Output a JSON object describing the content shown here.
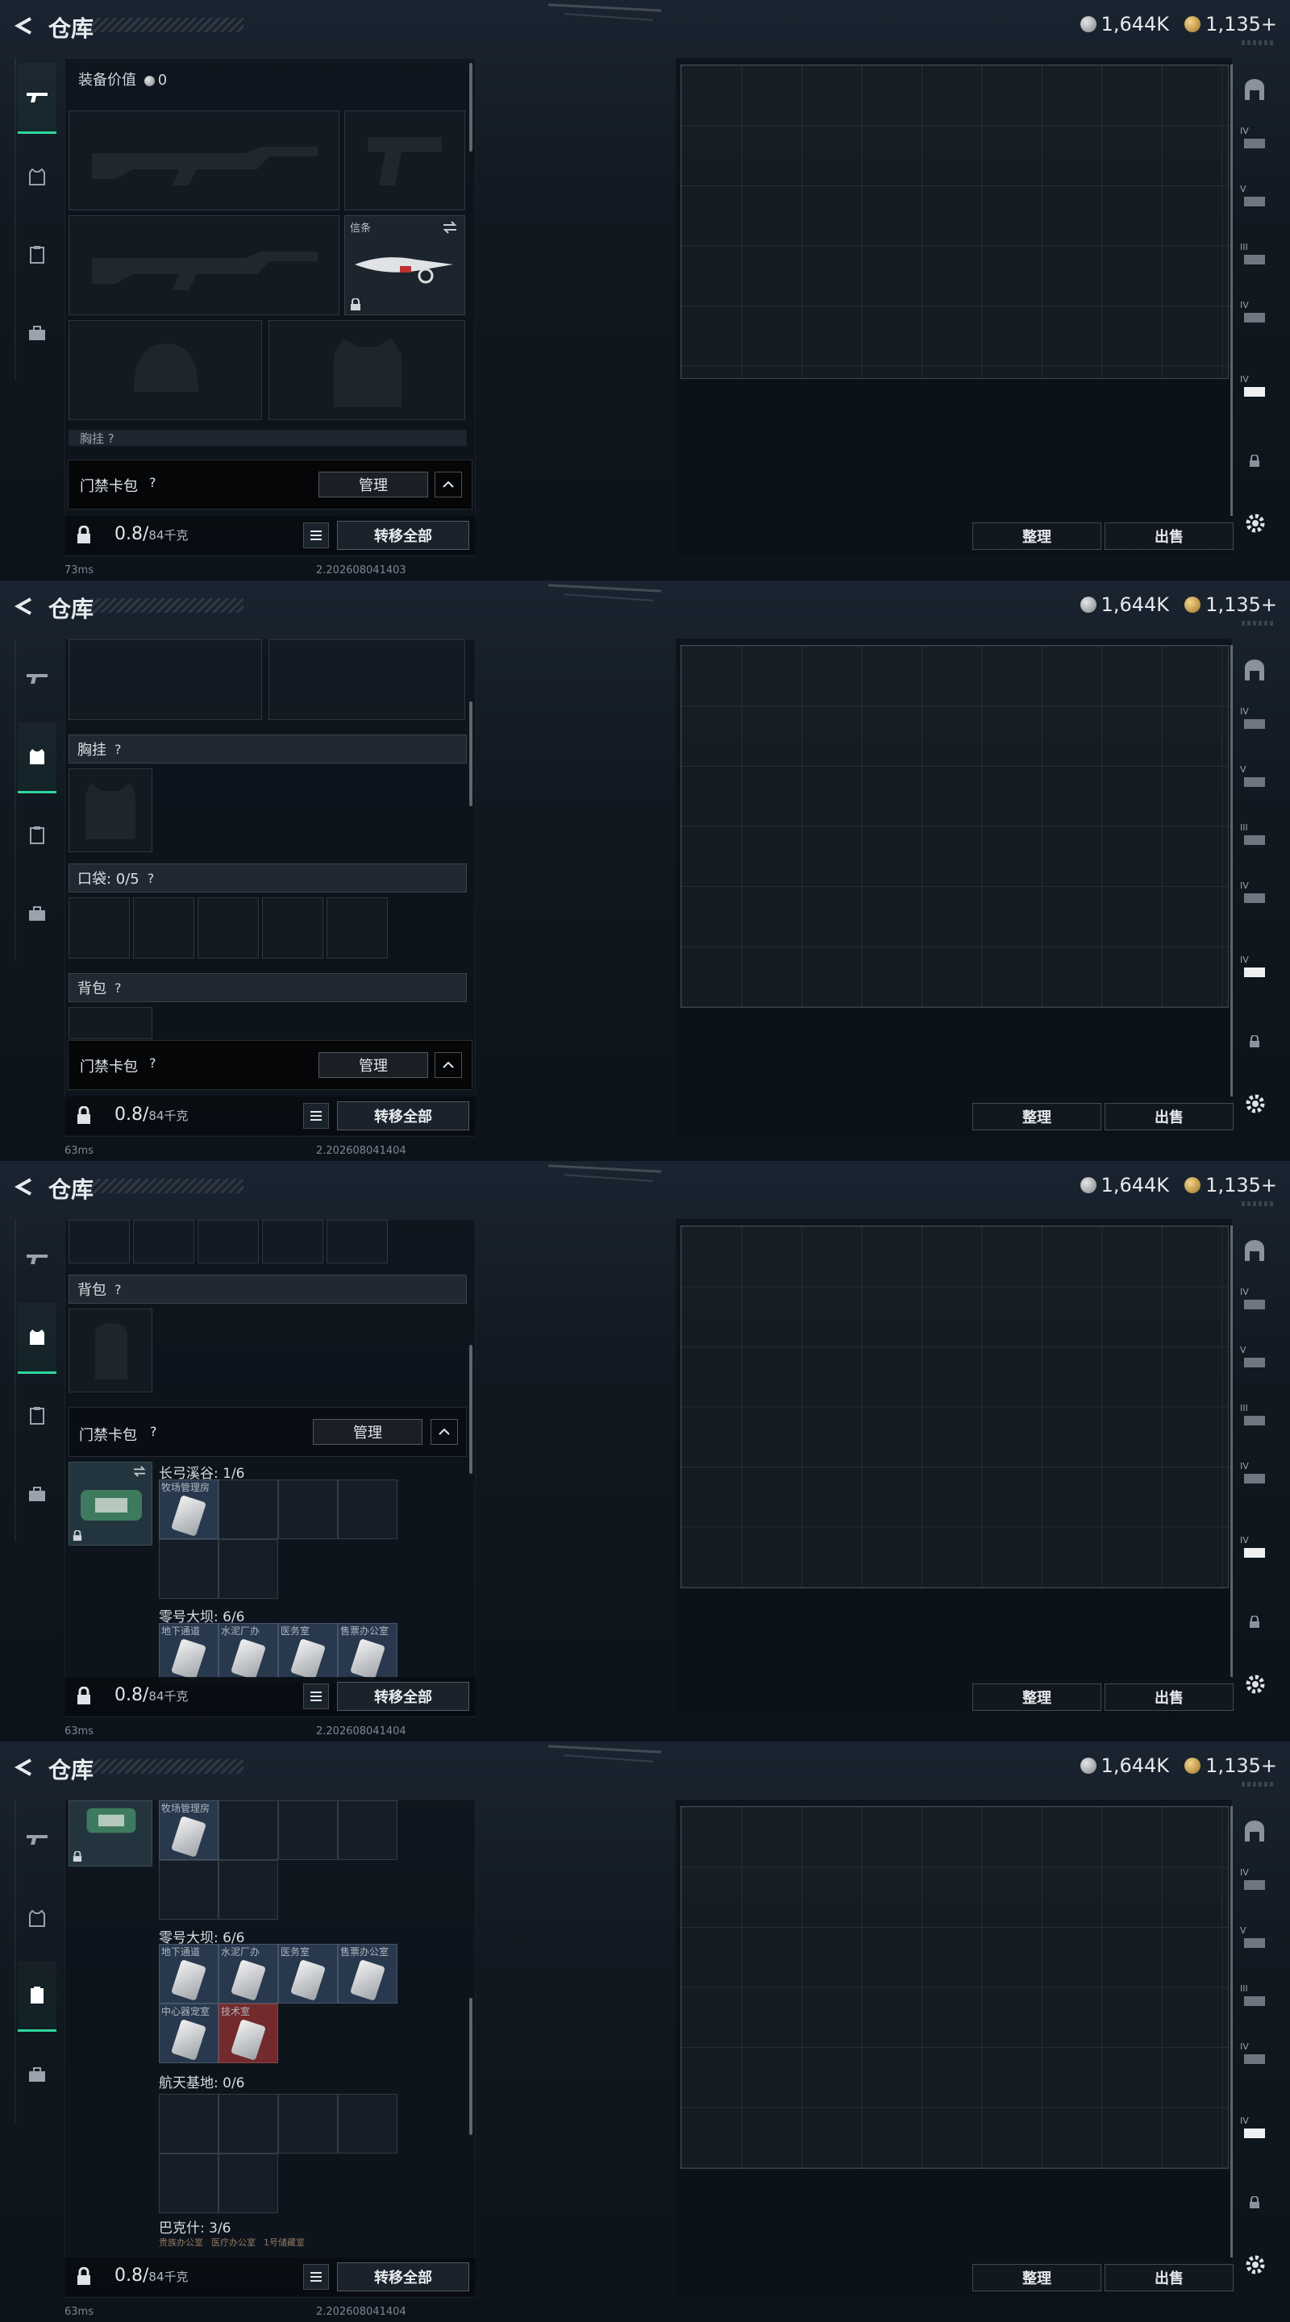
{
  "app": {
    "title": "仓库",
    "currency": {
      "silver": "1,644K",
      "gold": "1,135+"
    },
    "footer": {
      "weight": "0.8/",
      "weight_unit": "84千克",
      "transfer_all": "转移全部"
    },
    "keycard": {
      "label": "门禁卡包",
      "help": "?",
      "manage": "管理"
    },
    "stash_buttons": {
      "sort": "整理",
      "sell": "出售"
    }
  },
  "frames": [
    {
      "status": {
        "ping": "73ms",
        "version": "2.202608041403"
      },
      "equip_value_label": "装备价值",
      "equip_value": "0",
      "melee_label": "信条",
      "partial_label": "胸挂 ?"
    },
    {
      "status": {
        "ping": "63ms",
        "version": "2.202608041404"
      },
      "chest_rig": "胸挂",
      "pockets": "口袋: 0/5",
      "backpack": "背包",
      "help": "?"
    },
    {
      "status": {
        "ping": "63ms",
        "version": "2.202608041404"
      },
      "backpack": "背包",
      "help": "?",
      "group1": "长弓溪谷: 1/6",
      "card1": "牧场管理房",
      "group2": "零号大坝: 6/6",
      "cards2": [
        "地下通道",
        "水泥厂办",
        "医务室",
        "售票办公室"
      ]
    },
    {
      "status": {
        "ping": "63ms",
        "version": "2.202608041404"
      },
      "card1": "牧场管理房",
      "group2": "零号大坝: 6/6",
      "cards2": [
        "地下通道",
        "水泥厂办",
        "医务室",
        "售票办公室",
        "中心器宠室",
        "技术室"
      ],
      "group3": "航天基地: 0/6",
      "group4": "巴克什: 3/6",
      "cards4": [
        "贵族办公室",
        "医疗办公室",
        "1号储藏室"
      ]
    }
  ],
  "right_nav": {
    "tiers": [
      "",
      "IV",
      "V",
      "III",
      "IV",
      "IV",
      ""
    ]
  }
}
